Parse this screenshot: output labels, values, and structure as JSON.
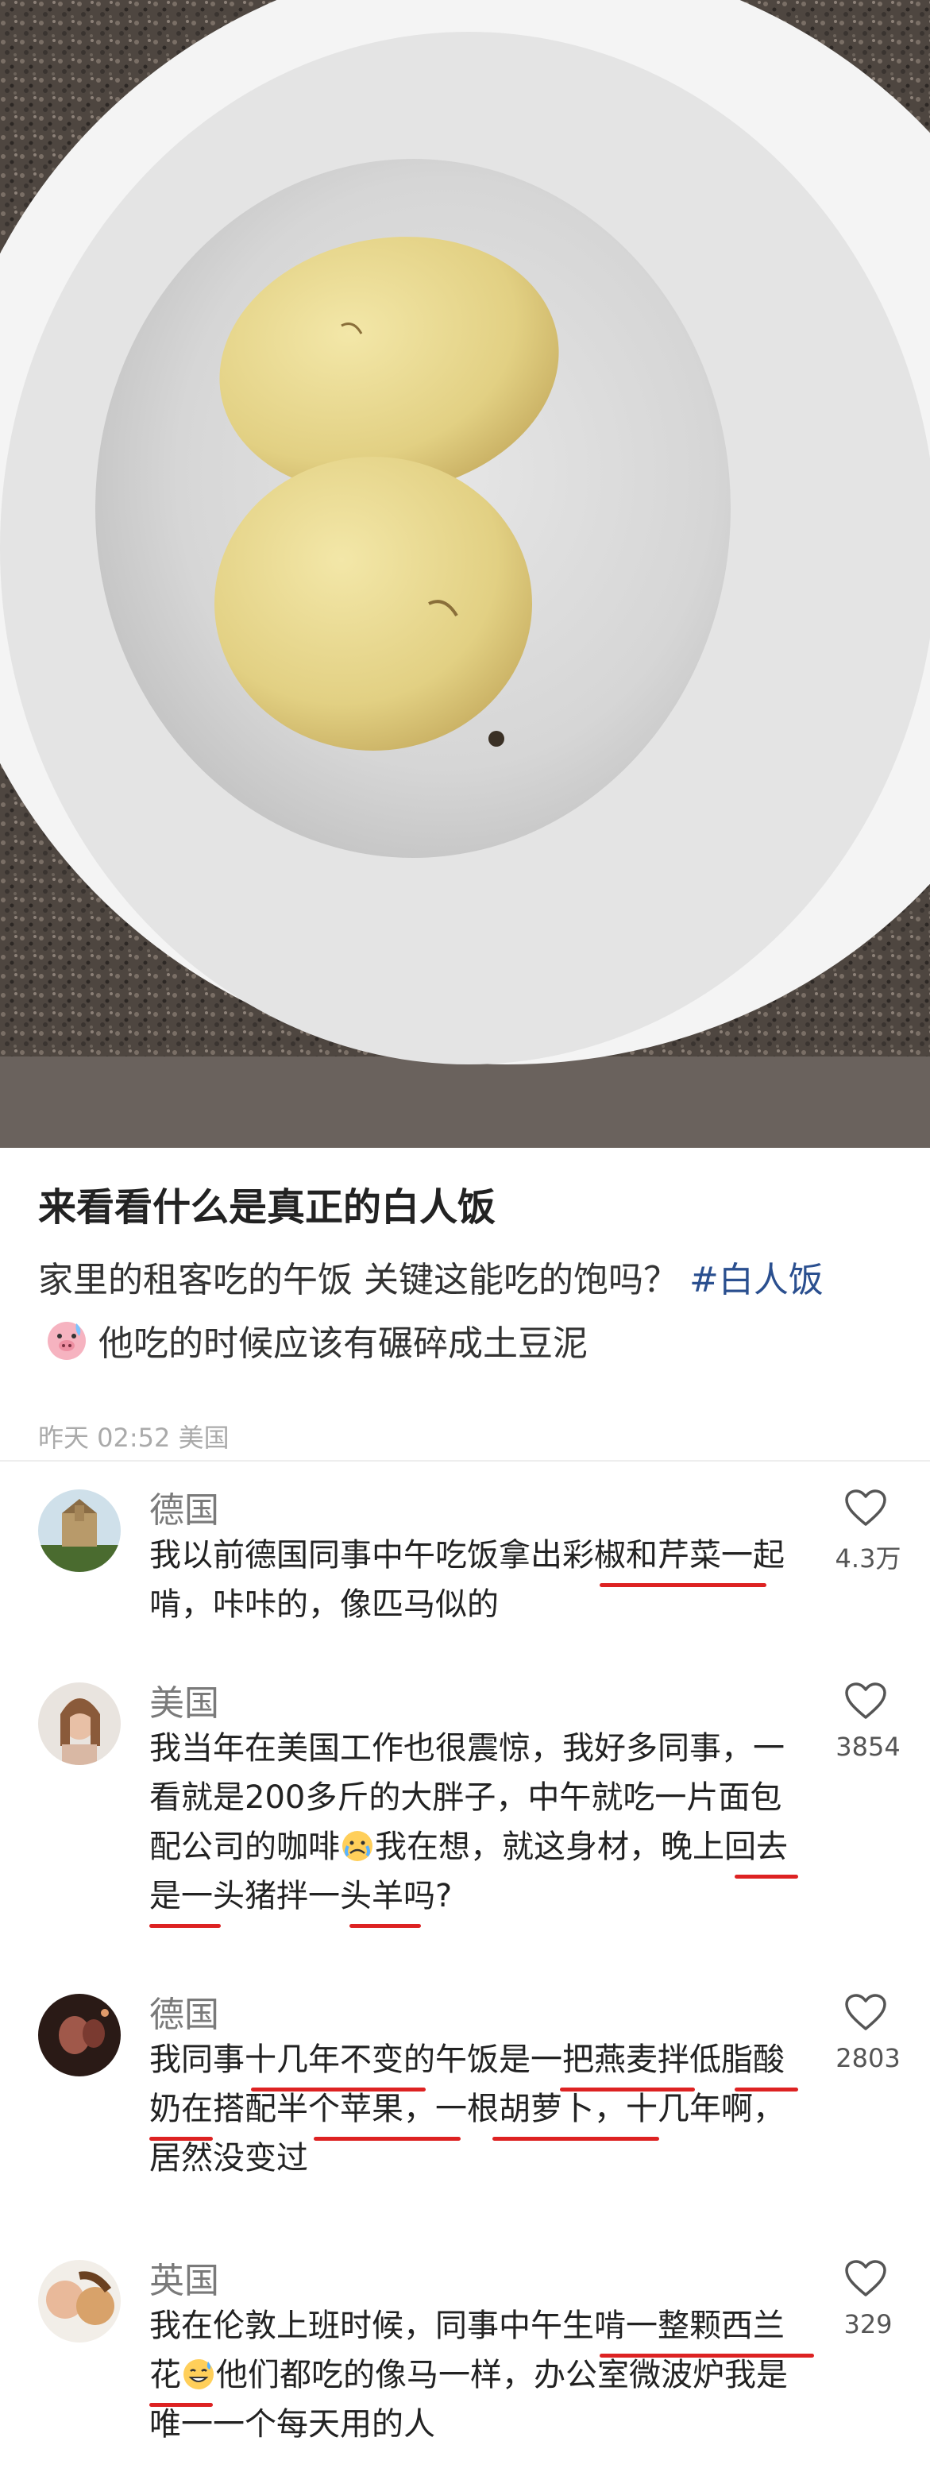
{
  "post": {
    "title": "来看看什么是真正的白人饭",
    "body_text": "家里的租客吃的午饭 关键这能吃的饱吗？",
    "hashtag": "#白人饭",
    "body_after_emoji": "他吃的时候应该有碾碎成土豆泥",
    "meta": "昨天 02:52 美国"
  },
  "comments": [
    {
      "region": "德国",
      "text": "我以前德国同事中午吃饭拿出彩椒和芹菜一起啃，咔咔的，像匹马似的",
      "likes": "4.3万"
    },
    {
      "region": "美国",
      "text_a": "我当年在美国工作也很震惊，我好多同事，一看就是200多斤的大胖子，中午就吃一片面包配公司的咖啡",
      "text_b": "我在想，就这身材，晚上回去是一头猪拌一头羊吗?",
      "likes": "3854"
    },
    {
      "region": "德国",
      "text": "我同事十几年不变的午饭是一把燕麦拌低脂酸奶在搭配半个苹果，一根胡萝卜，十几年啊，居然没变过",
      "likes": "2803"
    },
    {
      "region": "英国",
      "text_a": "我在伦敦上班时候，同事中午生啃一整颗西兰花",
      "text_b": "他们都吃的像马一样，办公室微波炉我是唯一一个每天用的人",
      "likes": "329"
    }
  ],
  "icons": [
    "heart-icon",
    "pig-face-emoji",
    "sweat-smile-emoji",
    "crying-face-emoji"
  ],
  "colors": {
    "underline": "#d22222",
    "hashtag": "#2a4f8f",
    "meta": "#aaaaaa"
  }
}
